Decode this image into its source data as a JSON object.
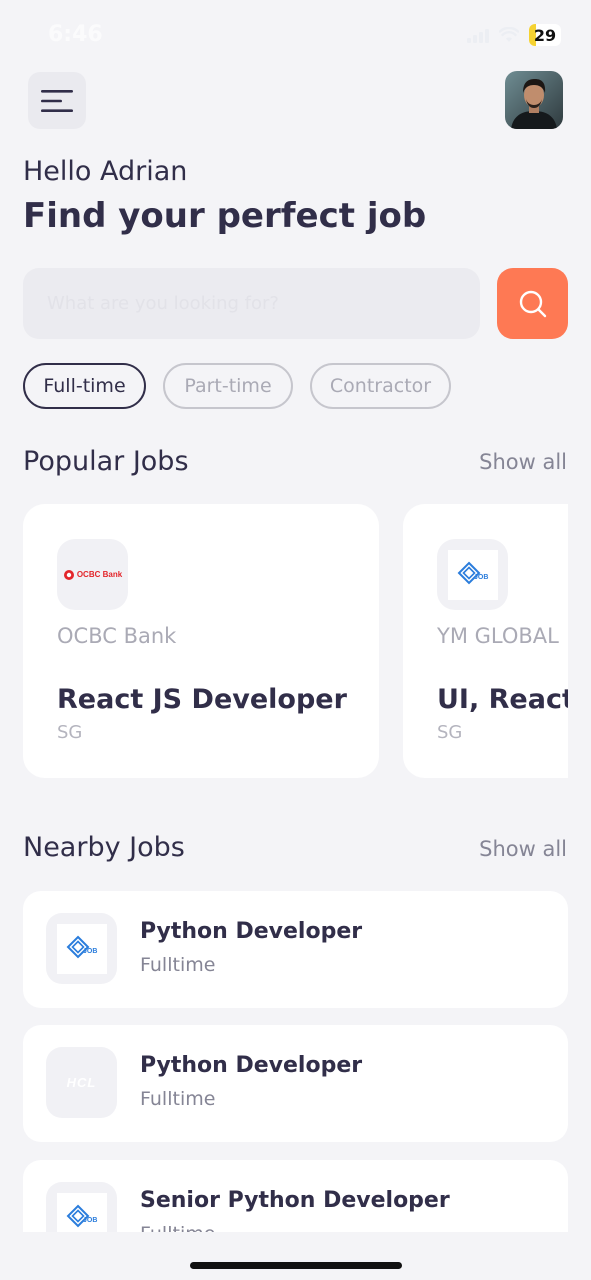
{
  "status_bar": {
    "time": "6:46",
    "battery": "29"
  },
  "header": {
    "greeting": "Hello Adrian",
    "title": "Find your perfect job"
  },
  "search": {
    "placeholder": "What are you looking for?"
  },
  "tabs": [
    {
      "label": "Full-time",
      "active": true
    },
    {
      "label": "Part-time",
      "active": false
    },
    {
      "label": "Contractor",
      "active": false
    }
  ],
  "popular": {
    "title": "Popular Jobs",
    "show_all": "Show all",
    "items": [
      {
        "company": "OCBC Bank",
        "logo_text": "OCBC Bank",
        "logo": "ocbc-logo",
        "title": "React JS Developer",
        "location": "SG"
      },
      {
        "company": "YM GLOBAL",
        "logo_text": "JOB",
        "logo": "job-logo",
        "title": "UI, React JS Developer",
        "location": "SG"
      }
    ]
  },
  "nearby": {
    "title": "Nearby Jobs",
    "show_all": "Show all",
    "items": [
      {
        "title": "Python Developer",
        "type": "Fulltime",
        "logo_text": "JOB",
        "logo": "job-logo"
      },
      {
        "title": "Python Developer",
        "type": "Fulltime",
        "logo_text": "HCL",
        "logo": "hcl-logo"
      },
      {
        "title": "Senior Python Developer",
        "type": "Fulltime",
        "logo_text": "JOB",
        "logo": "job-logo"
      }
    ]
  },
  "colors": {
    "accent": "#fe7954",
    "text": "#312e49",
    "muted": "#aaaab5",
    "background": "#f4f4f7"
  }
}
